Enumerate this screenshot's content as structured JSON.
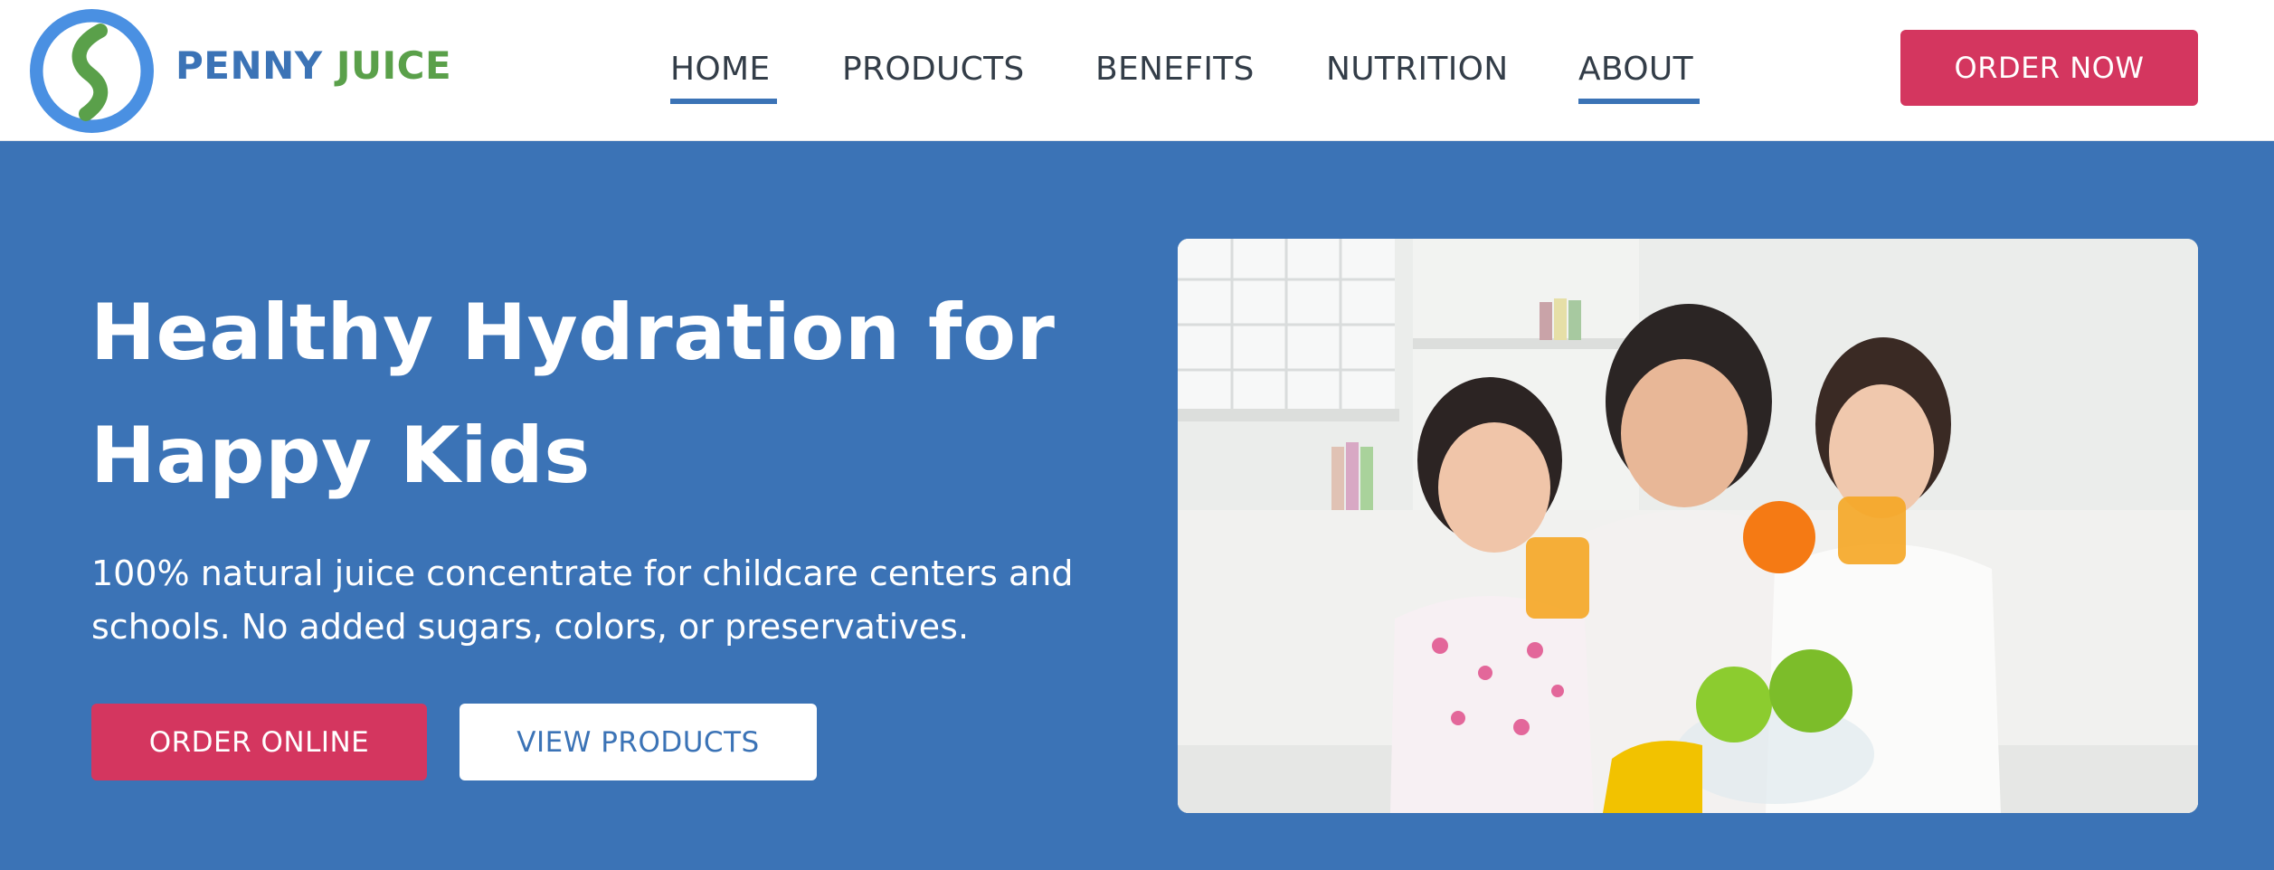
{
  "brand": {
    "name_part1": "PENNY",
    "name_part2": "JUICE",
    "logo_icon": "penny-juice-logo",
    "colors": {
      "blue": "#3b73b6",
      "green": "#5aa04a"
    }
  },
  "nav": {
    "items": [
      {
        "label": "HOME",
        "active": true
      },
      {
        "label": "PRODUCTS",
        "active": false
      },
      {
        "label": "BENEFITS",
        "active": false
      },
      {
        "label": "NUTRITION",
        "active": false
      },
      {
        "label": "ABOUT",
        "active": true
      }
    ],
    "cta_label": "ORDER NOW"
  },
  "hero": {
    "title_line1": "Healthy Hydration for",
    "title_line2": "Happy Kids",
    "subtitle_line1": "100% natural juice concentrate for childcare centers and",
    "subtitle_line2": "schools. No added sugars, colors, or preservatives.",
    "primary_button": "ORDER ONLINE",
    "secondary_button": "VIEW PRODUCTS",
    "image_subject": "family-drinking-juice-photo"
  },
  "colors": {
    "hero_background": "#3b73b6",
    "accent_pink": "#d4365f",
    "nav_text": "#333d48",
    "white": "#ffffff"
  }
}
